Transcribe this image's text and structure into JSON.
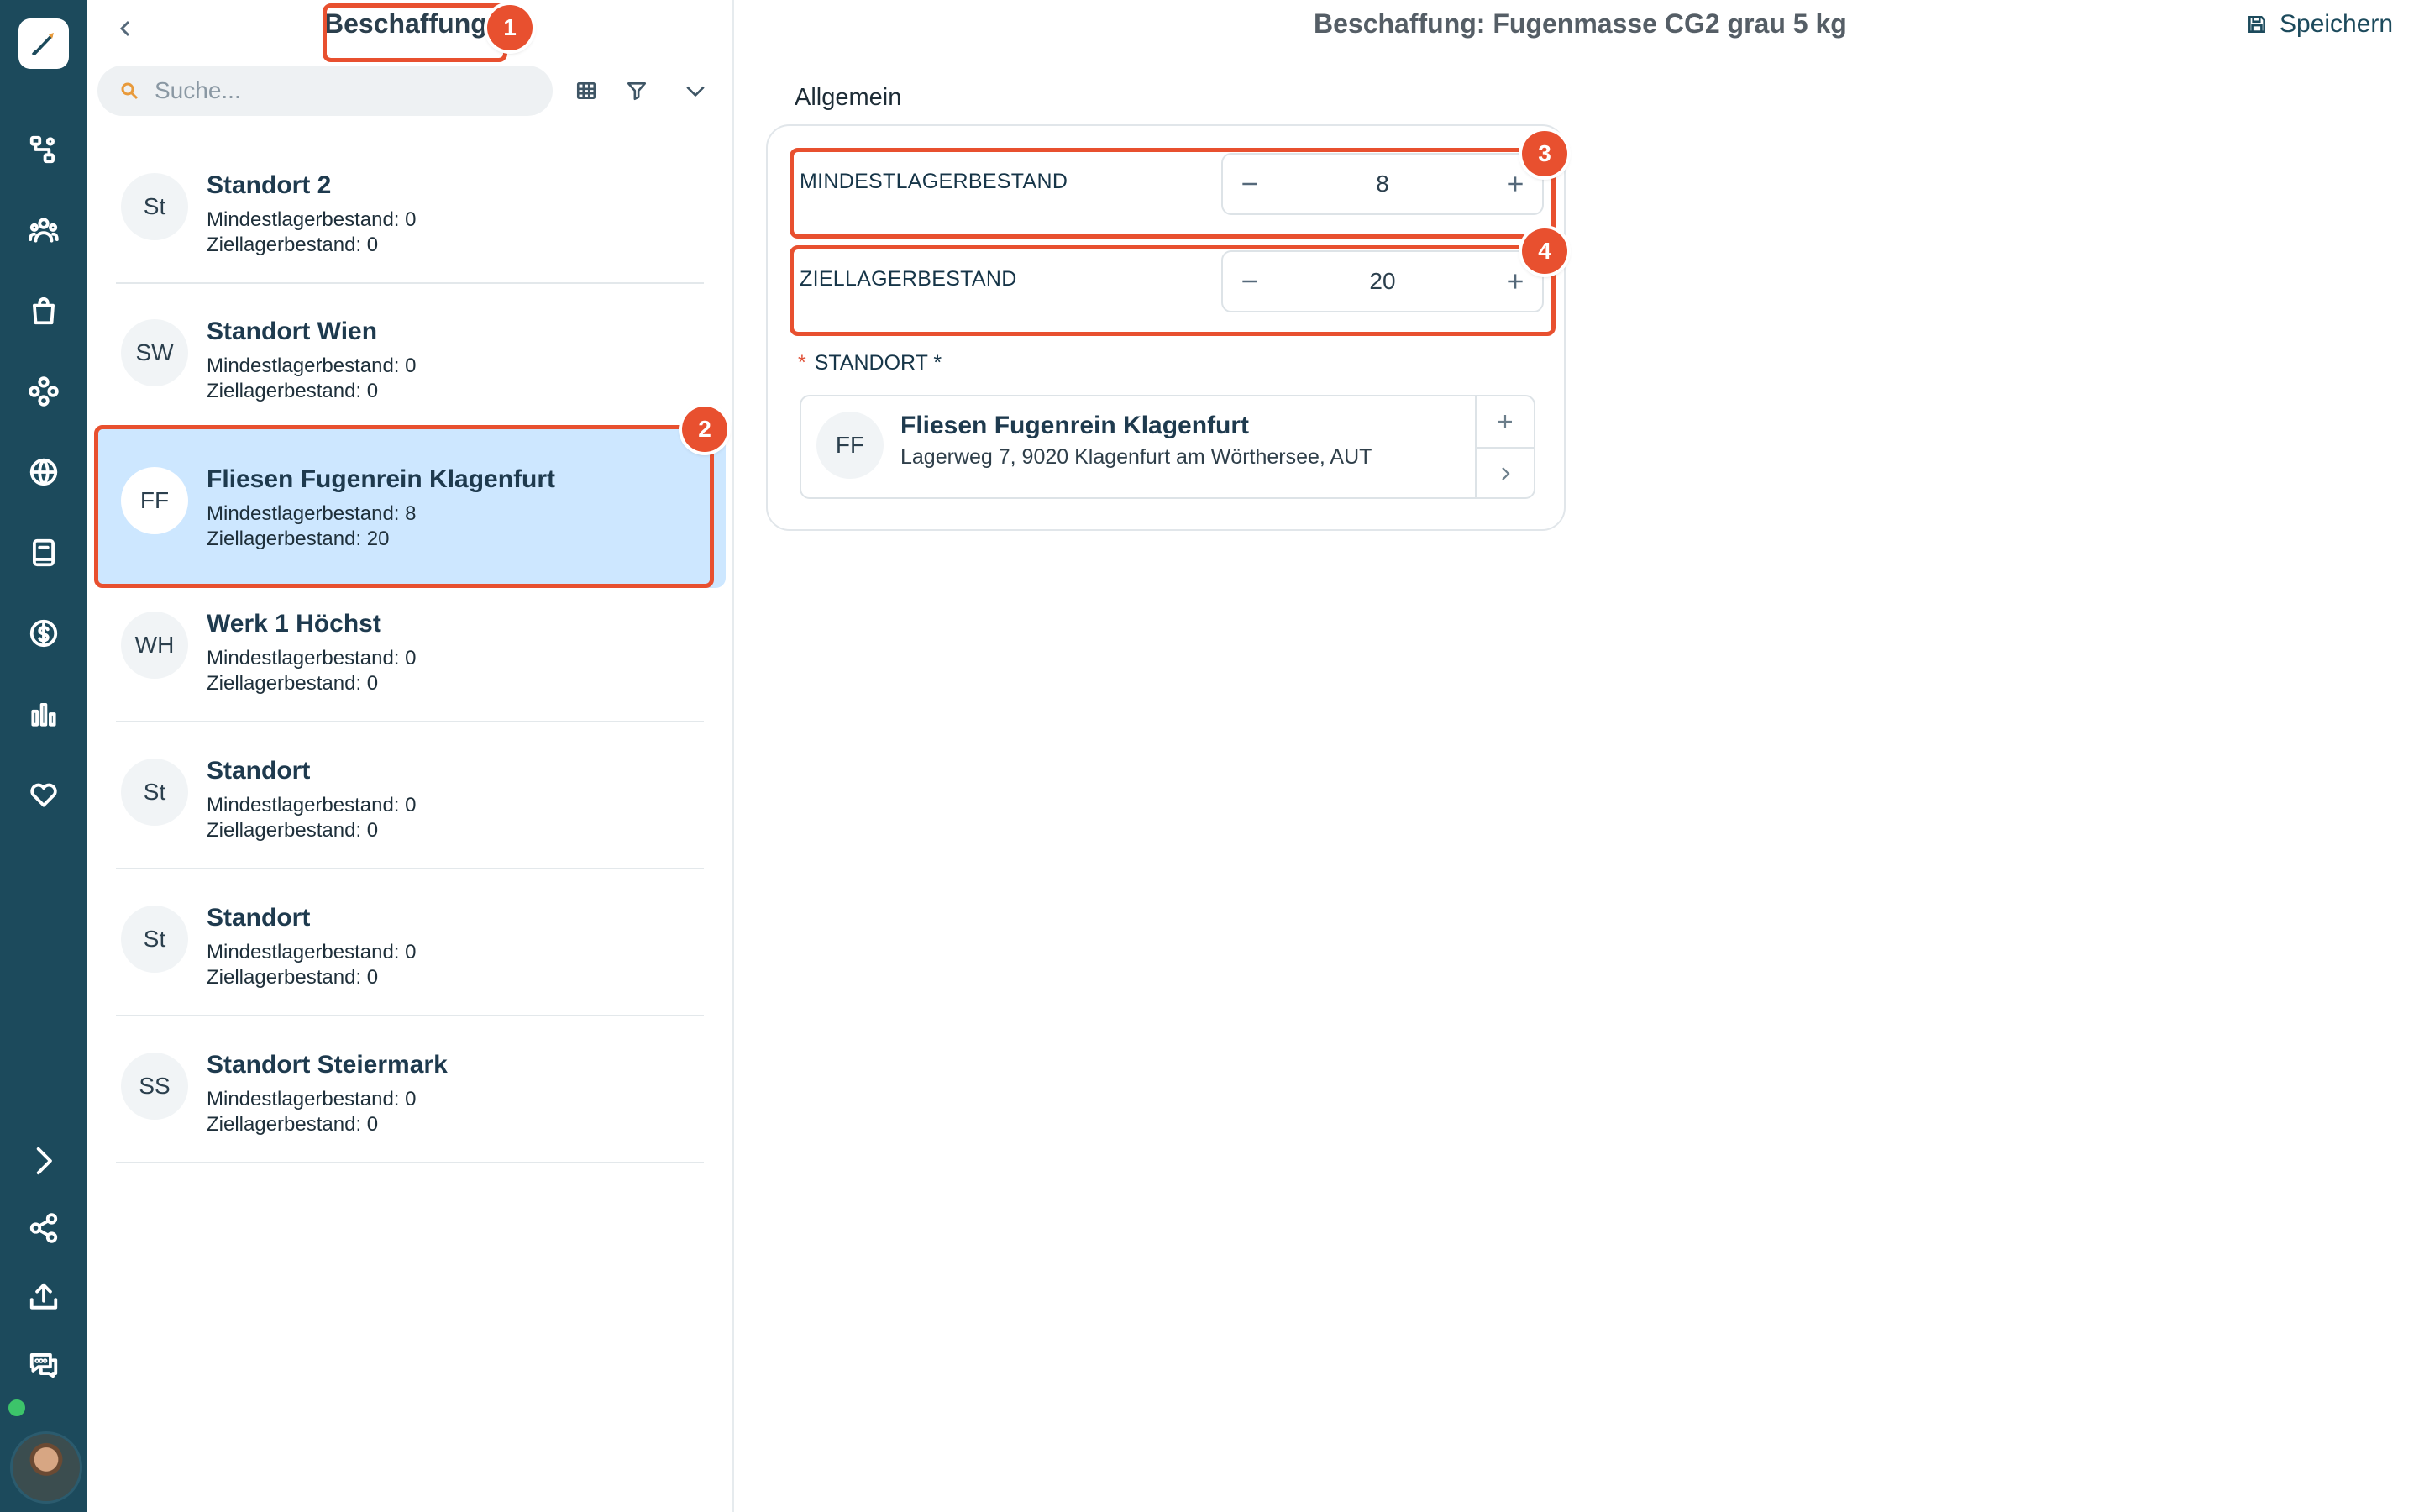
{
  "app": {
    "search_placeholder": "Suche...",
    "user_status": "online"
  },
  "list_panel": {
    "title": "Beschaffung",
    "items": [
      {
        "initials": "St",
        "name": "Standort 2",
        "min_line": "Mindestlagerbestand: 0",
        "target_line": "Ziellagerbestand: 0"
      },
      {
        "initials": "SW",
        "name": "Standort Wien",
        "min_line": "Mindestlagerbestand: 0",
        "target_line": "Ziellagerbestand: 0"
      },
      {
        "initials": "FF",
        "name": "Fliesen Fugenrein Klagenfurt",
        "min_line": "Mindestlagerbestand: 8",
        "target_line": "Ziellagerbestand: 20",
        "selected": true
      },
      {
        "initials": "WH",
        "name": "Werk 1 Höchst",
        "min_line": "Mindestlagerbestand: 0",
        "target_line": "Ziellagerbestand: 0"
      },
      {
        "initials": "St",
        "name": "Standort",
        "min_line": "Mindestlagerbestand: 0",
        "target_line": "Ziellagerbestand: 0"
      },
      {
        "initials": "St",
        "name": "Standort",
        "min_line": "Mindestlagerbestand: 0",
        "target_line": "Ziellagerbestand: 0"
      },
      {
        "initials": "SS",
        "name": "Standort Steiermark",
        "min_line": "Mindestlagerbestand: 0",
        "target_line": "Ziellagerbestand: 0"
      }
    ]
  },
  "main": {
    "title": "Beschaffung: Fugenmasse CG2 grau 5 kg",
    "save_label": "Speichern",
    "section": "Allgemein",
    "fields": {
      "min_label": "MINDESTLAGERBESTAND",
      "min_value": "8",
      "target_label": "ZIELLAGERBESTAND",
      "target_value": "20",
      "location_label": "STANDORT *",
      "location_required_mark": "*"
    },
    "location": {
      "initials": "FF",
      "name": "Fliesen Fugenrein Klagenfurt",
      "address": "Lagerweg 7, 9020 Klagenfurt am Wörthersee, AUT"
    }
  },
  "annotations": [
    "1",
    "2",
    "3",
    "4"
  ],
  "colors": {
    "rail": "#1c4a5c",
    "selected_row": "#cde7ff",
    "annotation": "#e8502f",
    "status_online": "#3cc46a"
  }
}
